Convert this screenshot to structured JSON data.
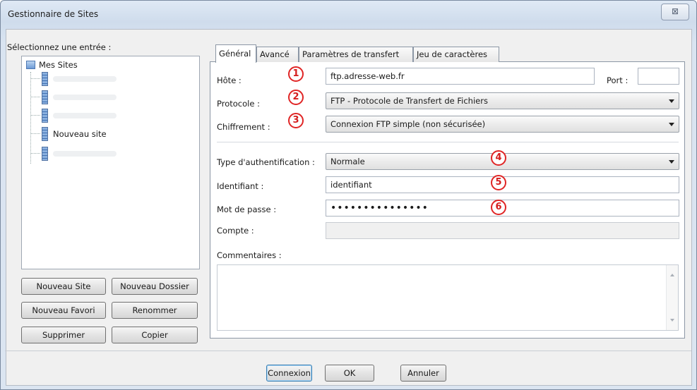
{
  "window": {
    "title": "Gestionnaire de Sites",
    "close_glyph": "⊠"
  },
  "left": {
    "label": "Sélectionnez une entrée :",
    "tree": {
      "root": "Mes Sites",
      "items": [
        "",
        "",
        "",
        "Nouveau site",
        ""
      ]
    },
    "buttons": {
      "new_site": "Nouveau Site",
      "new_folder": "Nouveau Dossier",
      "new_bookmark": "Nouveau Favori",
      "rename": "Renommer",
      "delete": "Supprimer",
      "copy": "Copier"
    }
  },
  "tabs": [
    "Général",
    "Avancé",
    "Paramètres de transfert",
    "Jeu de caractères"
  ],
  "form": {
    "host_label": "Hôte :",
    "host_value": "ftp.adresse-web.fr",
    "port_label": "Port :",
    "port_value": "",
    "protocol_label": "Protocole :",
    "protocol_value": "FTP - Protocole de Transfert de Fichiers",
    "encryption_label": "Chiffrement :",
    "encryption_value": "Connexion FTP simple (non sécurisée)",
    "auth_label": "Type d'authentification :",
    "auth_value": "Normale",
    "user_label": "Identifiant :",
    "user_value": "identifiant",
    "password_label": "Mot de passe :",
    "password_value": "•••••••••••••••",
    "account_label": "Compte :",
    "account_value": "",
    "comments_label": "Commentaires :"
  },
  "annotations": [
    "1",
    "2",
    "3",
    "4",
    "5",
    "6"
  ],
  "colors": {
    "annotation": "#e02525",
    "window_chrome": "#dbe5f1"
  },
  "footer": {
    "connect": "Connexion",
    "ok": "OK",
    "cancel": "Annuler"
  }
}
